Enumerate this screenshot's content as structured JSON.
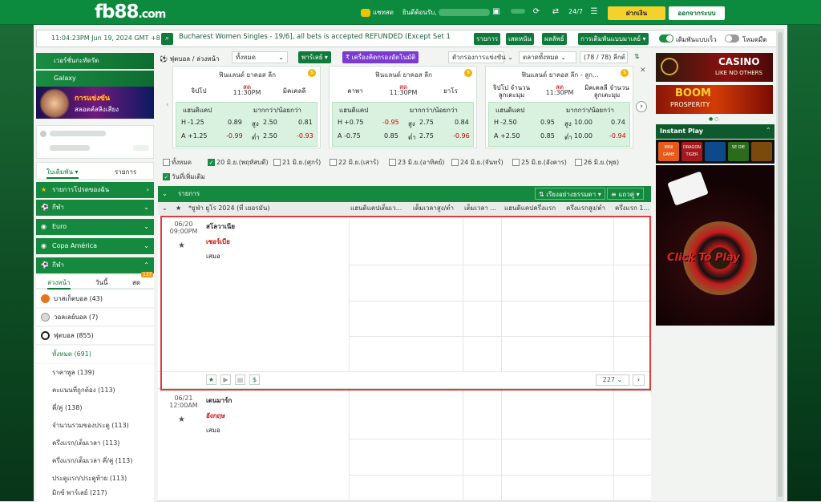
{
  "topbar": {
    "logo": "fb88",
    "logo_suffix": ".com",
    "chat": "แชทสด",
    "welcome": "ยินดีต้อนรับ,",
    "deposit": "ฝากเงิน",
    "logout": "ออกจากระบบ"
  },
  "ticker": {
    "clock": "11:04:23PM Jun 19, 2024 GMT +8",
    "message": "Bucharest Women Singles - 19/6], all bets is accepted REFUNDED (Except Set 1",
    "btn_items": "รายการ",
    "btn_results": "เสดหนัน",
    "btn_live": "ผลลัพธ์",
    "btn_settings": "การเดิมพันแบบมาเลย์",
    "toggle1": "เดิมพันแบบเร็ว",
    "toggle2": "โหมดมืด"
  },
  "left": {
    "banner1": "เวอร์ชั่นกะทัดรัด",
    "banner2": "Galaxy",
    "promo_title": "การแข่งขัน",
    "promo_sub": "สลอตค์สลิงเสียง",
    "tab_bets": "ใบเดิมพัน",
    "tab_list": "รายการ",
    "nav_fav": "รายการโปรดของฉัน",
    "nav_sport": "กีฬา",
    "nav_euro": "Euro",
    "nav_copa": "Copa América",
    "nav_sport2": "กีฬา",
    "sub_tab1": "ล่วงหน้า",
    "sub_tab2": "วันนี้",
    "sub_tab3": "สด",
    "sub_badge": "137",
    "sports": [
      {
        "name": "บาสเก็ตบอล",
        "count": "(43)"
      },
      {
        "name": "วอลเลย์บอล",
        "count": "(7)"
      },
      {
        "name": "ฟุตบอล",
        "count": "(855)"
      }
    ],
    "subitems": [
      "ทั้งหมด (691)",
      "ราคาพูล (139)",
      "คะแนนที่ถูกต้อง (113)",
      "คี่/คู่ (138)",
      "จำนวนรวมของประตู (113)",
      "ครึ่งแรก/เต็มเวลา (113)",
      "ครึ่งแรก/เต็มเวลา คี่/คู่ (113)",
      "ประตูแรก/ประตูท้าย (113)",
      "มิกซ์ พาร์เลย์ (217)"
    ]
  },
  "center": {
    "title": "ฟุตบอล / ล่วงหน้า",
    "filter": "ทั้งหมด",
    "parlay": "พาร์เลย์",
    "parlay_btn": "เครื่องคิดกรองอัตโนมัติ",
    "filter_bets": "ตัวกรองการแข่งขัน",
    "market": "ตลาดทั้งหมด",
    "leagues": "(78 / 78) ลีกต์",
    "cards": [
      {
        "league": "ฟินแลนด์ ยาคอส ลีก",
        "team1": "จิปโป",
        "team2": "มิคเคลลี",
        "status": "สด",
        "time": "11:30PM",
        "h_lbl": "แฮนดิแคป",
        "ou_lbl": "มากกว่า/น้อยกว่า",
        "r1": [
          "H",
          "-1.25",
          "0.89",
          "สูง",
          "2.50",
          "0.81"
        ],
        "r2": [
          "A",
          "+1.25",
          "-0.99",
          "ต่ำ",
          "2.50",
          "-0.93"
        ]
      },
      {
        "league": "ฟินแลนด์ ยาคอส ลีก",
        "team1": "คาพา",
        "team2": "ยาโร",
        "status": "สด",
        "time": "11:30PM",
        "h_lbl": "แฮนดิแคป",
        "ou_lbl": "มากกว่า/น้อยกว่า",
        "r1": [
          "H",
          "+0.75",
          "-0.95",
          "สูง",
          "2.75",
          "0.84"
        ],
        "r2": [
          "A",
          "-0.75",
          "0.85",
          "ต่ำ",
          "2.75",
          "-0.96"
        ]
      },
      {
        "league": "ฟินแลนด์ ยาคอส ลีก - ลูก...",
        "team1": "จิปโป จำนวนลูกเตะมุม",
        "team2": "มิคเคลลี จำนวนลูกเตะมุม",
        "status": "สด",
        "time": "11:30PM",
        "h_lbl": "แฮนดิแคป",
        "ou_lbl": "มากกว่า/น้อยกว่า",
        "r1": [
          "H",
          "-2.50",
          "0.95",
          "สูง",
          "10.00",
          "0.74"
        ],
        "r2": [
          "A",
          "+2.50",
          "0.85",
          "ต่ำ",
          "10.00",
          "-0.94"
        ]
      }
    ],
    "dates": [
      "ทั้งหมด",
      "20 มิ.ย.(พฤหัสบดี)",
      "21 มิ.ย.(ศุกร์)",
      "22 มิ.ย.(เสาร์)",
      "23 มิ.ย.(อาทิตย์)",
      "24 มิ.ย.(จันทร์)",
      "25 มิ.ย.(อังคาร)",
      "26 มิ.ย.(พุธ)",
      "วันที่เพิ่มเติม"
    ],
    "grid_title": "รายการ",
    "sort": "เรียงอย่างธรรมดา",
    "view": "แถวคู่",
    "cols": [
      "*ยูฟ่า ยูโร 2024 (ที่ เยอรมัน)",
      "แฮนดิแคปเต็มเว...",
      "เต็มเวลาสูง/ต่ำ",
      "เต็มเวลา ...",
      "แฮนดิแคปครึ่งแรก",
      "ครึ่งแรกสูง/ต่ำ",
      "ครึ่งแรก 1..."
    ],
    "m1": {
      "date": "06/20",
      "time": "09:00PM",
      "team1": "สโลวาเนีย",
      "team2": "เซอร์เบีย",
      "draw": "เสมอ",
      "more": "227"
    },
    "m2": {
      "date": "06/21",
      "time": "12:00AM",
      "team1": "เดนมาร์ก",
      "team2": "อังกฤษ",
      "draw": "เสมอ"
    }
  },
  "right": {
    "casino1": "CASINO",
    "casino1_sub": "LIKE NO OTHERS",
    "casino2": "BOOM",
    "casino2_sub": "PROSPERITY",
    "instant": "Instant Play",
    "click": "Click To Play",
    "games": [
      "MINI GAME",
      "DRAGON TIGER",
      "",
      "SE DIE",
      ""
    ]
  }
}
